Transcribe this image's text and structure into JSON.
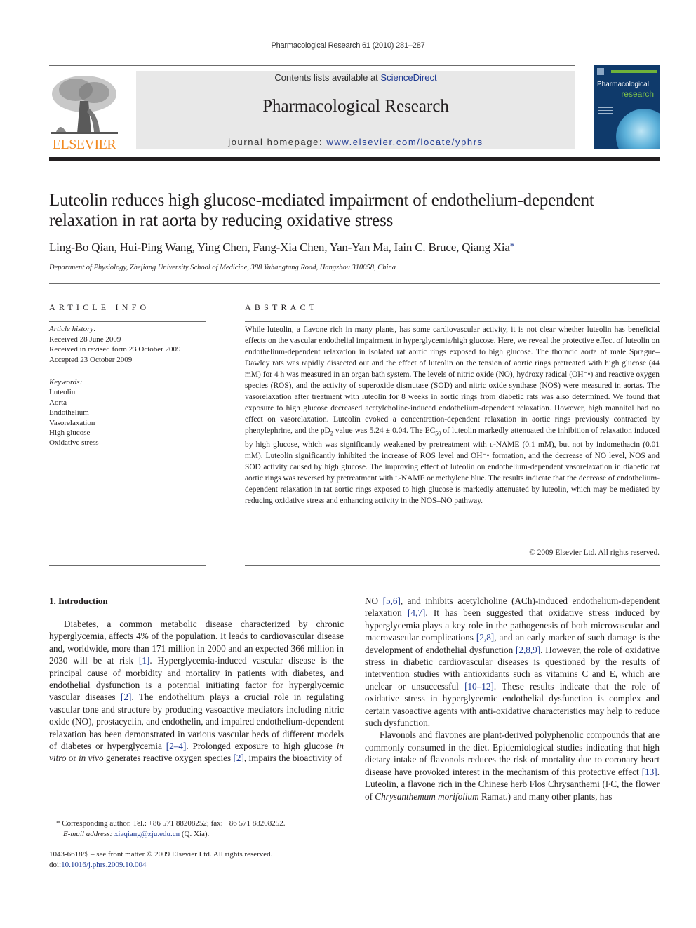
{
  "header": {
    "running_head": "Pharmacological Research 61 (2010) 281–287",
    "contents_prefix": "Contents lists available at ",
    "contents_link": "ScienceDirect",
    "journal_name": "Pharmacological Research",
    "homepage_prefix": "journal homepage: ",
    "homepage_link": "www.elsevier.com/locate/yphrs",
    "publisher_logo": "ELSEVIER",
    "cover_title_1": "Pharmacological",
    "cover_title_2": "research"
  },
  "article": {
    "title": "Luteolin reduces high glucose-mediated impairment of endothelium-dependent relaxation in rat aorta by reducing oxidative stress",
    "authors": "Ling-Bo Qian, Hui-Ping Wang, Ying Chen, Fang-Xia Chen, Yan-Yan Ma, Iain C. Bruce, Qiang Xia",
    "corresponding_mark": "*",
    "affiliation": "Department of Physiology, Zhejiang University School of Medicine, 388 Yuhangtang Road, Hangzhou 310058, China"
  },
  "article_info": {
    "heading": "ARTICLE INFO",
    "history_label": "Article history:",
    "history": [
      "Received 28 June 2009",
      "Received in revised form 23 October 2009",
      "Accepted 23 October 2009"
    ],
    "keywords_label": "Keywords:",
    "keywords": [
      "Luteolin",
      "Aorta",
      "Endothelium",
      "Vasorelaxation",
      "High glucose",
      "Oxidative stress"
    ]
  },
  "abstract": {
    "heading": "ABSTRACT",
    "p1": "While luteolin, a flavone rich in many plants, has some cardiovascular activity, it is not clear whether luteolin has beneficial effects on the vascular endothelial impairment in hyperglycemia/high glucose. Here, we reveal the protective effect of luteolin on endothelium-dependent relaxation in isolated rat aortic rings exposed to high glucose. The thoracic aorta of male Sprague–Dawley rats was rapidly dissected out and the effect of luteolin on the tension of aortic rings pretreated with high glucose (44 mM) for 4 h was measured in an organ bath system. The levels of nitric oxide (NO), hydroxy radical (OH⁻•) and reactive oxygen species (ROS), and the activity of superoxide dismutase (SOD) and nitric oxide synthase (NOS) were measured in aortas. The vasorelaxation after treatment with luteolin for 8 weeks in aortic rings from diabetic rats was also determined. We found that exposure to high glucose decreased acetylcholine-induced endothelium-dependent relaxation. However, high mannitol had no effect on vasorelaxation. Luteolin evoked a concentration-dependent relaxation in aortic rings previously contracted by phenylephrine, and the pD",
    "p1_sub": "2",
    "p2": " value was 5.24 ± 0.04. The EC",
    "p2_sub": "50",
    "p3": " of luteolin markedly attenuated the inhibition of relaxation induced by high glucose, which was significantly weakened by pretreatment with ",
    "lname_1": "l",
    "p4": "-NAME (0.1 mM), but not by indomethacin (0.01 mM). Luteolin significantly inhibited the increase of ROS level and OH⁻• formation, and the decrease of NO level, NOS and SOD activity caused by high glucose. The improving effect of luteolin on endothelium-dependent vasorelaxation in diabetic rat aortic rings was reversed by pretreatment with ",
    "lname_2": "l",
    "p5": "-NAME or methylene blue. The results indicate that the decrease of endothelium-dependent relaxation in rat aortic rings exposed to high glucose is markedly attenuated by luteolin, which may be mediated by reducing oxidative stress and enhancing activity in the NOS–NO pathway.",
    "copyright": "© 2009 Elsevier Ltd. All rights reserved."
  },
  "body": {
    "section_heading": "1.  Introduction",
    "left": {
      "t1": "Diabetes, a common metabolic disease characterized by chronic hyperglycemia, affects 4% of the population. It leads to cardiovascular disease and, worldwide, more than 171 million in 2000 and an expected 366 million in 2030 will be at risk ",
      "c1": "[1]",
      "t2": ". Hyperglycemia-induced vascular disease is the principal cause of morbidity and mortality in patients with diabetes, and endothelial dysfunction is a potential initiating factor for hyperglycemic vascular diseases ",
      "c2": "[2]",
      "t3": ". The endothelium plays a crucial role in regulating vascular tone and structure by producing vasoactive mediators including nitric oxide (NO), prostacyclin, and endothelin, and impaired endothelium-dependent relaxation has been demonstrated in various vascular beds of different models of diabetes or hyperglycemia ",
      "c3": "[2–4]",
      "t4": ". Prolonged exposure to high glucose ",
      "i1": "in vitro",
      "t5": " or ",
      "i2": "in vivo",
      "t6": " generates reactive oxygen species ",
      "c4": "[2]",
      "t7": ", impairs the bioactivity of"
    },
    "right": {
      "t1": "NO ",
      "c1": "[5,6]",
      "t2": ", and inhibits acetylcholine (ACh)-induced endothelium-dependent relaxation ",
      "c2": "[4,7]",
      "t3": ". It has been suggested that oxidative stress induced by hyperglycemia plays a key role in the pathogenesis of both microvascular and macrovascular complications ",
      "c3": "[2,8]",
      "t4": ", and an early marker of such damage is the development of endothelial dysfunction ",
      "c4": "[2,8,9]",
      "t5": ". However, the role of oxidative stress in diabetic cardiovascular diseases is questioned by the results of intervention studies with antioxidants such as vitamins C and E, which are unclear or unsuccessful ",
      "c5": "[10–12]",
      "t6": ". These results indicate that the role of oxidative stress in hyperglycemic endothelial dysfunction is complex and certain vasoactive agents with anti-oxidative characteristics may help to reduce such dysfunction.",
      "p2_t1": "Flavonols and flavones are plant-derived polyphenolic compounds that are commonly consumed in the diet. Epidemiological studies indicating that high dietary intake of flavonols reduces the risk of mortality due to coronary heart disease have provoked interest in the mechanism of this protective effect ",
      "p2_c1": "[13]",
      "p2_t2": ". Luteolin, a flavone rich in the Chinese herb Flos Chrysanthemi (FC, the flower of ",
      "p2_i1": "Chrysanthemum morifolium",
      "p2_t3": " Ramat.) and many other plants, has"
    }
  },
  "footnote": {
    "mark": "*",
    "text": " Corresponding author. Tel.: +86 571 88208252; fax: +86 571 88208252.",
    "email_label": "E-mail address:",
    "email": "xiaqiang@zju.edu.cn",
    "email_suffix": " (Q. Xia)."
  },
  "front_matter": {
    "issn_line": "1043-6618/$ – see front matter © 2009 Elsevier Ltd. All rights reserved.",
    "doi_prefix": "doi:",
    "doi": "10.1016/j.phrs.2009.10.004"
  },
  "colors": {
    "link": "#1f3a93",
    "elsevier_orange": "#f28a22",
    "masthead_bg": "#e8e8e8",
    "cover_bg": "#0f3a6b",
    "cover_accent": "#6fb23a"
  }
}
